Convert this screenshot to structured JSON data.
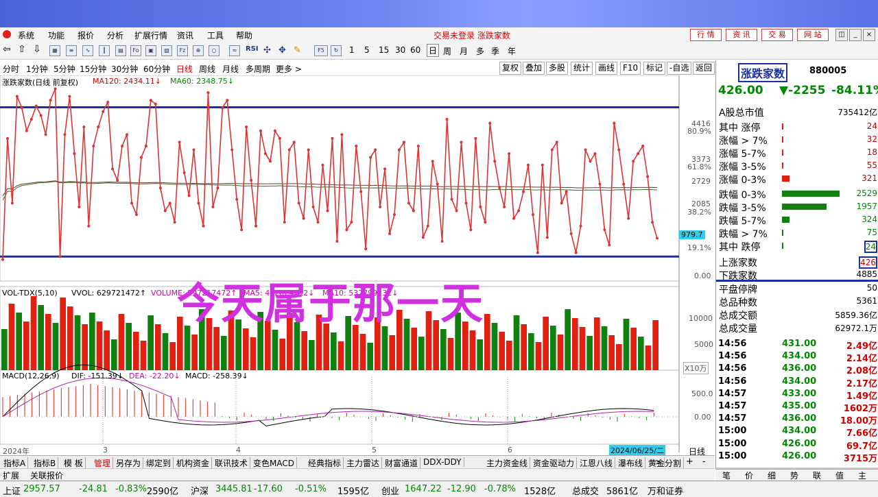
{
  "menu": {
    "items": [
      "系统",
      "功能",
      "报价",
      "分析",
      "扩展行情",
      "资讯",
      "工具",
      "帮助"
    ],
    "login_status": "交易未登录  涨跌家数"
  },
  "top_tabs": [
    "行 情",
    "资 讯",
    "交 易",
    "网 站"
  ],
  "toolbar": {
    "intervals": [
      "1",
      "5",
      "15",
      "30",
      "60"
    ],
    "periods": [
      "日",
      "周",
      "月",
      "多",
      "季",
      "年"
    ],
    "f5": "F5"
  },
  "period_tabs": [
    "分时",
    "1分钟",
    "5分钟",
    "15分钟",
    "30分钟",
    "60分钟",
    "日线",
    "周线",
    "月线",
    "多周期",
    "更多 >"
  ],
  "right_buttons": [
    "复权",
    "叠加",
    "多股",
    "统计",
    "画线",
    "F10",
    "标记",
    "-自选",
    "返回"
  ],
  "chart": {
    "title": "涨跌家数(日线 前复权)",
    "ma120": "MA120: 2434.11↓",
    "ma60": "MA60: 2348.75↓",
    "y_labels": [
      "4416",
      "80.9%",
      "3373",
      "61.8%",
      "2729",
      "2085",
      "38.2%",
      "19.1%",
      "0.00"
    ],
    "cursor_value": "979.7",
    "overlay_text": "今天属于那一天",
    "vol_legend": "VOL-TDX(5,10)",
    "vvol": "VVOL: 629721472↑",
    "volume": "VOLUME: 297217472↑",
    "ma5": "MA5: 442824512↓",
    "ma10": "MA10: 537799232↓",
    "vol_labels": [
      "10000",
      "5000",
      "X10万"
    ],
    "macd_legend": "MACD(12,26,9)",
    "dif": "DIF: -151.39↓",
    "dea": "DEA: -22.20↓",
    "macd_val": "MACD: -258.39↓",
    "macd_labels": [
      "500.0",
      "0.00"
    ],
    "x_axis": [
      "2024年",
      "3",
      "4",
      "5",
      "6"
    ],
    "date_label": "2024/06/25/二",
    "daily_label": "日线",
    "colors": {
      "price": "#d33",
      "level": "#1a2fa0",
      "up_bar": "#e02010",
      "down_bar": "#108010",
      "macd_dif": "#000",
      "macd_dea": "#b020b0",
      "overlay": "#d030e0"
    }
  },
  "chart_data": {
    "type": "line",
    "series": [
      {
        "name": "涨跌家数",
        "values": [
          420,
          3600,
          1900,
          4700,
          4400,
          3800,
          4100,
          4450,
          4200,
          3700,
          4600,
          4900,
          500,
          3700,
          4700,
          3200,
          1800,
          3900,
          1300,
          3400,
          3900,
          4300,
          4550,
          2800,
          2500,
          3400,
          3700,
          1900,
          1600,
          3100,
          3400,
          4600,
          4500,
          2300,
          1700,
          1900,
          1400,
          3500,
          2700,
          2100,
          3300,
          1900,
          1300,
          4800,
          1800,
          2300,
          4400,
          4600,
          3300,
          2000,
          1200,
          3900,
          2500,
          1300,
          3800,
          3200,
          3000,
          3800,
          3600,
          1400,
          3300,
          3500,
          1900,
          1500,
          3300,
          1800,
          1400,
          2900,
          1700,
          3600,
          900,
          3700,
          1200,
          1400,
          3400,
          2200,
          700,
          3100,
          3300,
          1800,
          2800,
          1100,
          1600,
          3300,
          3500,
          1900,
          1700,
          3400,
          1000,
          1300,
          3000,
          2400,
          900,
          4100,
          2000,
          1700,
          3500,
          1900,
          1200,
          3600,
          1800,
          1400,
          4000,
          3000,
          2300,
          1800,
          3200,
          1500,
          1700,
          2200,
          2900,
          1600,
          600,
          2900,
          1000,
          3300,
          3500,
          1900,
          2200,
          1100,
          600,
          1300,
          3300,
          3000,
          3200,
          2400,
          1200,
          800,
          4000,
          3300,
          2400,
          1500,
          3000,
          3200,
          3400,
          2600,
          1400,
          980
        ]
      }
    ],
    "ylim": [
      0,
      5000
    ],
    "levels": [
      4416,
      500
    ]
  },
  "right_panel": {
    "name": "涨跌家数",
    "code": "880005",
    "price": "426.00",
    "change": "▼-2255",
    "pct": "-84.11%",
    "rows": [
      {
        "label": "A股总市值",
        "value": "735412亿"
      },
      {
        "label": "其中 涨停",
        "value": "24"
      },
      {
        "label": "涨幅 > 7%",
        "value": "32"
      },
      {
        "label": "涨幅 5-7%",
        "value": "18"
      },
      {
        "label": "涨幅 3-5%",
        "value": "55"
      },
      {
        "label": "涨幅 0-3%",
        "value": "321"
      },
      {
        "label": "跌幅 0-3%",
        "value": "2529"
      },
      {
        "label": "跌幅 3-5%",
        "value": "1957"
      },
      {
        "label": "跌幅 5-7%",
        "value": "324"
      },
      {
        "label": "跌幅 > 7%",
        "value": "75"
      },
      {
        "label": "其中 跌停",
        "value": "24"
      },
      {
        "label": "上涨家数",
        "value": "426"
      },
      {
        "label": "下跌家数",
        "value": "4885"
      },
      {
        "label": "平盘停牌",
        "value": "50"
      },
      {
        "label": "总品种数",
        "value": "5361"
      },
      {
        "label": "总成交额",
        "value": "5859.36亿"
      },
      {
        "label": "总成交量",
        "value": "62972.1万"
      }
    ],
    "bar_counts": [
      24,
      32,
      18,
      55,
      321,
      2529,
      1957,
      324,
      75,
      24
    ],
    "ticks": [
      {
        "time": "14:56",
        "price": "431.00",
        "vol": "2.49亿"
      },
      {
        "time": "14:56",
        "price": "434.00",
        "vol": "2.14亿"
      },
      {
        "time": "14:56",
        "price": "436.00",
        "vol": "2.08亿"
      },
      {
        "time": "14:56",
        "price": "434.00",
        "vol": "2.17亿"
      },
      {
        "time": "14:57",
        "price": "433.00",
        "vol": "1.49亿"
      },
      {
        "time": "14:57",
        "price": "435.00",
        "vol": "1602万"
      },
      {
        "time": "14:57",
        "price": "436.00",
        "vol": "18.00万"
      },
      {
        "time": "15:00",
        "price": "434.00",
        "vol": "7.66亿"
      },
      {
        "time": "15:00",
        "price": "426.00",
        "vol": "69.7亿"
      },
      {
        "time": "15:00",
        "price": "426.00",
        "vol": "3715万"
      }
    ],
    "bottom_tabs": [
      "笔",
      "价",
      "细",
      "势",
      "联",
      "值",
      "主"
    ]
  },
  "indicator_tabs": [
    "指标A",
    "指标B",
    "模 板",
    "管理",
    "另存为",
    "绑定到",
    "机构资金",
    "联讯技术",
    "变色MACD",
    "经典指标",
    "主力雷达",
    "财富通道",
    "DDX-DDY",
    "主力资金线",
    "资金驱动力",
    "江恩八线",
    "瀑布线",
    "黄金分割"
  ],
  "sub_tabs": [
    "扩展",
    "关联报价"
  ],
  "status": {
    "sh_label": "上证",
    "sh_price": "2957.57",
    "sh_chg": "-24.81",
    "sh_pct": "-0.83%",
    "sh_amt": "2590亿",
    "sz_label": "沪深",
    "sz_price": "3445.81",
    "sz_chg": "-17.60",
    "sz_pct": "-0.51%",
    "sz_amt": "1595亿",
    "cy_label": "创业",
    "cy_price": "1647.22",
    "cy_chg": "-12.90",
    "cy_pct": "-0.78%",
    "cy_amt": "1528亿",
    "total_label": "总成交",
    "total": "5861亿",
    "broker": "万和证券"
  }
}
